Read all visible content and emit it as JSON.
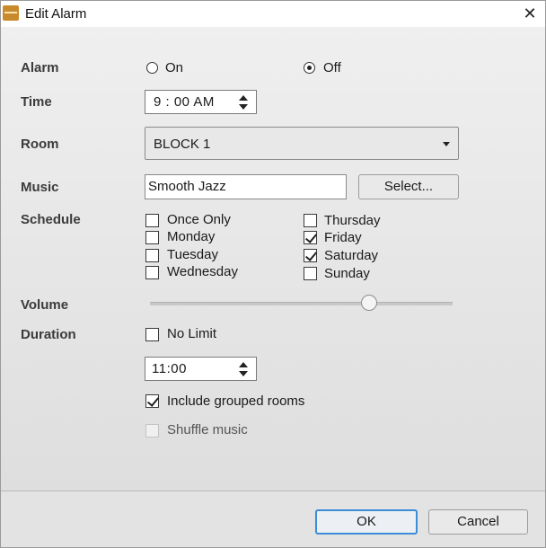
{
  "window": {
    "title": "Edit Alarm",
    "close_glyph": "✕",
    "app_icon": "speaker-app-icon"
  },
  "alarm": {
    "label": "Alarm",
    "on_label": "On",
    "off_label": "Off",
    "selected": "Off"
  },
  "time": {
    "label": "Time",
    "value": "9 : 00  AM"
  },
  "room": {
    "label": "Room",
    "value": "BLOCK 1"
  },
  "music": {
    "label": "Music",
    "value": "Smooth Jazz",
    "select_label": "Select..."
  },
  "schedule": {
    "label": "Schedule",
    "options": [
      {
        "label": "Once Only",
        "checked": false
      },
      {
        "label": "Monday",
        "checked": false
      },
      {
        "label": "Tuesday",
        "checked": false
      },
      {
        "label": "Wednesday",
        "checked": false
      },
      {
        "label": "Thursday",
        "checked": false
      },
      {
        "label": "Friday",
        "checked": true
      },
      {
        "label": "Saturday",
        "checked": true
      },
      {
        "label": "Sunday",
        "checked": false
      }
    ]
  },
  "volume": {
    "label": "Volume",
    "level_fraction": 0.72
  },
  "duration": {
    "label": "Duration",
    "no_limit_label": "No Limit",
    "no_limit_checked": false,
    "value": "11:00"
  },
  "include_grouped": {
    "label": "Include grouped rooms",
    "checked": true
  },
  "shuffle": {
    "label": "Shuffle music",
    "checked": false,
    "enabled": false
  },
  "buttons": {
    "ok": "OK",
    "cancel": "Cancel"
  },
  "colors": {
    "dialog_bg": "#e6e6e6",
    "default_button_border": "#3c8cd8",
    "app_icon": "#c98a2c"
  }
}
